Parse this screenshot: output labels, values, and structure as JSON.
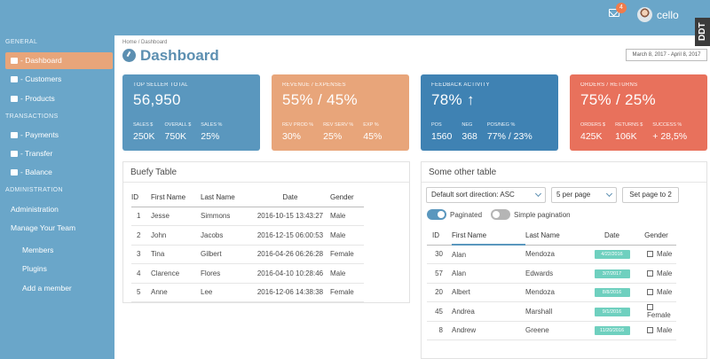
{
  "topbar": {
    "badge_count": "4",
    "username": "cello",
    "ddt_label": "DDT"
  },
  "sidebar": {
    "sections": [
      {
        "label": "GENERAL"
      },
      {
        "label": "TRANSACTIONS"
      },
      {
        "label": "ADMINISTRATION"
      }
    ],
    "items": [
      {
        "label": "- Dashboard"
      },
      {
        "label": "- Customers"
      },
      {
        "label": "- Products"
      },
      {
        "label": "- Payments"
      },
      {
        "label": "- Transfer"
      },
      {
        "label": "- Balance"
      },
      {
        "label": "Administration"
      },
      {
        "label": "Manage Your Team"
      },
      {
        "label": "Members"
      },
      {
        "label": "Plugins"
      },
      {
        "label": "Add a member"
      }
    ]
  },
  "breadcrumb": {
    "home": "Home",
    "sep": "/",
    "current": "Dashboard"
  },
  "page_title": "Dashboard",
  "date_range": "March 8, 2017 - April 8, 2017",
  "tiles": [
    {
      "title": "TOP SELLER TOTAL",
      "value": "56,950",
      "color": "#5a97be",
      "stats": [
        {
          "label": "SALES $",
          "value": "250K"
        },
        {
          "label": "OVERALL $",
          "value": "750K"
        },
        {
          "label": "SALES %",
          "value": "25%"
        }
      ]
    },
    {
      "title": "REVENUE / EXPENSES",
      "value": "55% / 45%",
      "color": "#e8a57a",
      "stats": [
        {
          "label": "REV PROD %",
          "value": "30%"
        },
        {
          "label": "REV SERV %",
          "value": "25%"
        },
        {
          "label": "EXP %",
          "value": "45%"
        }
      ]
    },
    {
      "title": "FEEDBACK ACTIVITY",
      "value": "78% ↑",
      "color": "#3f82b3",
      "stats": [
        {
          "label": "POS",
          "value": "1560"
        },
        {
          "label": "NEG",
          "value": "368"
        },
        {
          "label": "POS/NEG %",
          "value": "77% / 23%"
        }
      ]
    },
    {
      "title": "ORDERS / RETURNS",
      "value": "75% / 25%",
      "color": "#e8715c",
      "stats": [
        {
          "label": "ORDERS $",
          "value": "425K"
        },
        {
          "label": "RETURNS $",
          "value": "106K"
        },
        {
          "label": "SUCCESS %",
          "value": "+ 28,5%"
        }
      ]
    }
  ],
  "buefy_table": {
    "title": "Buefy Table",
    "columns": [
      "ID",
      "First Name",
      "Last Name",
      "Date",
      "Gender"
    ],
    "rows": [
      [
        "1",
        "Jesse",
        "Simmons",
        "2016-10-15 13:43:27",
        "Male"
      ],
      [
        "2",
        "John",
        "Jacobs",
        "2016-12-15 06:00:53",
        "Male"
      ],
      [
        "3",
        "Tina",
        "Gilbert",
        "2016-04-26 06:26:28",
        "Female"
      ],
      [
        "4",
        "Clarence",
        "Flores",
        "2016-04-10 10:28:46",
        "Male"
      ],
      [
        "5",
        "Anne",
        "Lee",
        "2016-12-06 14:38:38",
        "Female"
      ]
    ]
  },
  "other_table": {
    "title": "Some other table",
    "sort_select": "Default sort direction: ASC",
    "per_page_select": "5 per page",
    "set_page_button": "Set page to 2",
    "paginated_label": "Paginated",
    "simple_pagination_label": "Simple pagination",
    "columns": [
      "ID",
      "First Name",
      "Last Name",
      "Date",
      "Gender"
    ],
    "rows": [
      [
        "30",
        "Alan",
        "Mendoza",
        "4/22/2016",
        "Male"
      ],
      [
        "57",
        "Alan",
        "Edwards",
        "3/7/2017",
        "Male"
      ],
      [
        "20",
        "Albert",
        "Mendoza",
        "8/8/2016",
        "Male"
      ],
      [
        "45",
        "Andrea",
        "Marshall",
        "9/1/2016",
        "Female"
      ],
      [
        "8",
        "Andrew",
        "Greene",
        "11/20/2016",
        "Male"
      ]
    ]
  }
}
